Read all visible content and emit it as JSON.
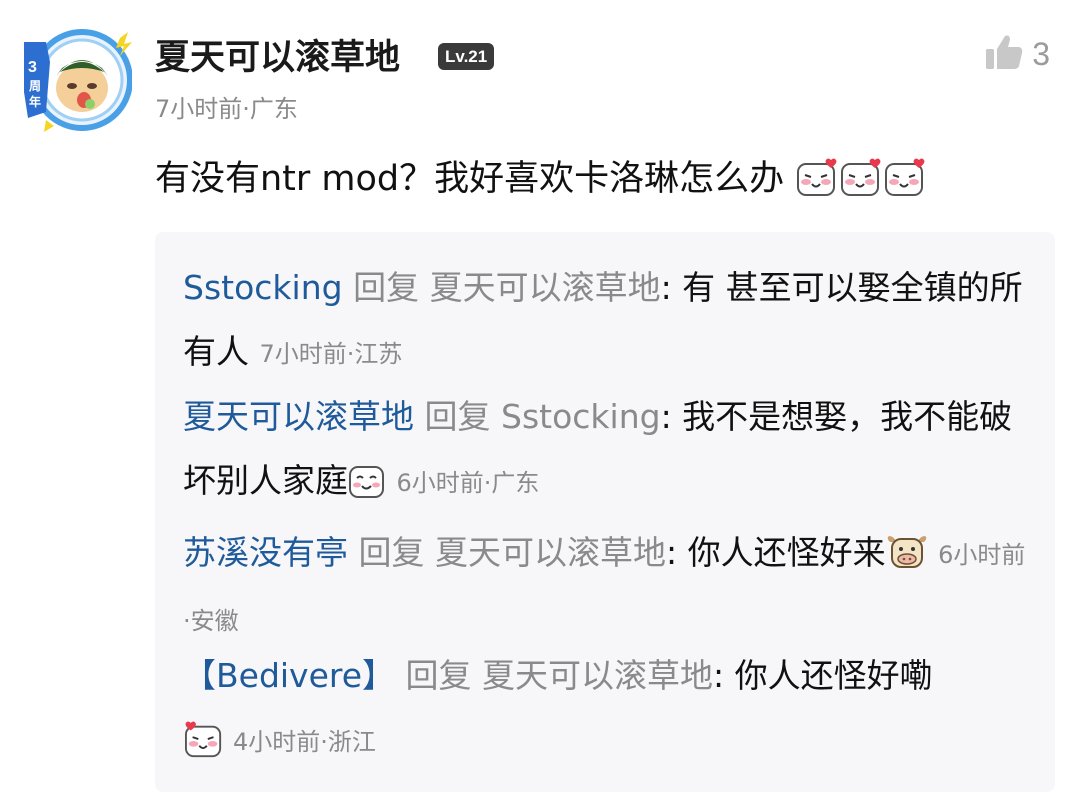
{
  "comment": {
    "username": "夏天可以滚草地",
    "level": "Lv.21",
    "avatar_badge": "3周年",
    "time": "7小时前",
    "location": "广东",
    "text": "有没有ntr mod？我好喜欢卡洛琳怎么办",
    "likes": "3",
    "icons": [
      "shy-face-icon",
      "shy-face-icon",
      "shy-face-icon"
    ]
  },
  "replies": [
    {
      "author": "Sstocking",
      "verb": "回复",
      "target": "夏天可以滚草地",
      "text": "有 甚至可以娶全镇的所有人",
      "time": "7小时前",
      "location": "江苏"
    },
    {
      "author": "夏天可以滚草地",
      "verb": "回复",
      "target": "Sstocking",
      "text": "我不是想娶，我不能破坏别人家庭",
      "emoji": "smile-face-icon",
      "time": "6小时前",
      "location": "广东"
    },
    {
      "author": "苏溪没有亭",
      "verb": "回复",
      "target": "夏天可以滚草地",
      "text": "你人还怪好来",
      "emoji": "cow-face-icon",
      "time": "6小时前",
      "location": "安徽"
    },
    {
      "author": "【Bedivere】",
      "verb": "回复",
      "target": "夏天可以滚草地",
      "text": "你人还怪好嘞",
      "emoji": "shy-face-icon",
      "time": "4小时前",
      "location": "浙江"
    }
  ],
  "colors": {
    "author": "#1f5a9a",
    "muted": "#8a8a8a",
    "panel": "#f7f7f9",
    "badge": "#3a3a3a"
  }
}
